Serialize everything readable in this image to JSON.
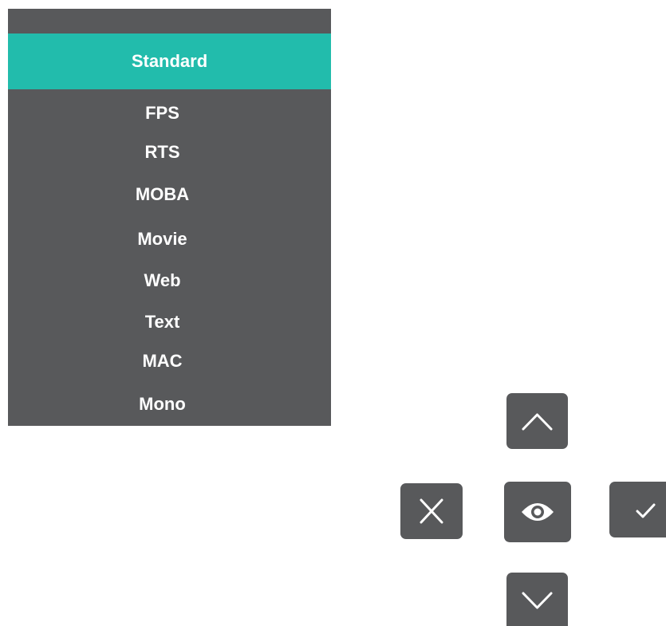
{
  "osd_menu": {
    "items": [
      {
        "label": "Standard",
        "selected": true
      },
      {
        "label": "FPS",
        "selected": false
      },
      {
        "label": "RTS",
        "selected": false
      },
      {
        "label": "MOBA",
        "selected": false
      },
      {
        "label": "Movie",
        "selected": false
      },
      {
        "label": "Web",
        "selected": false
      },
      {
        "label": "Text",
        "selected": false
      },
      {
        "label": "MAC",
        "selected": false
      },
      {
        "label": "Mono",
        "selected": false
      }
    ]
  },
  "controls": {
    "up": {
      "icon": "chevron-up-icon"
    },
    "close": {
      "icon": "close-icon"
    },
    "view": {
      "icon": "eye-icon"
    },
    "confirm": {
      "icon": "checkmark-icon"
    },
    "down": {
      "icon": "chevron-down-icon"
    }
  },
  "colors": {
    "panel": "#58595b",
    "highlight": "#22bcac",
    "text": "#ffffff",
    "background": "#ffffff"
  }
}
